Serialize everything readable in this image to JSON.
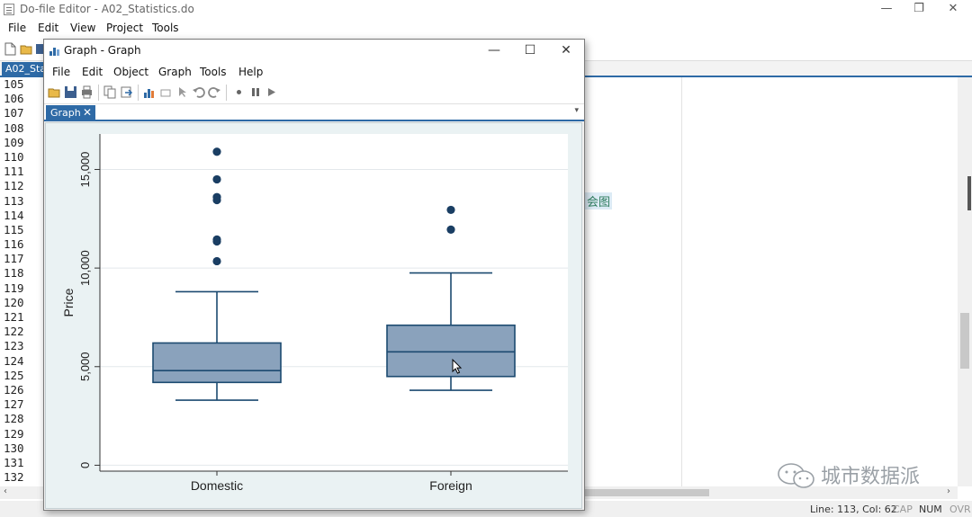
{
  "editor": {
    "title": "Do-file Editor - A02_Statistics.do",
    "menu": [
      "File",
      "Edit",
      "View",
      "Project",
      "Tools"
    ],
    "tab_label": "A02_Statistics.do",
    "line_numbers": [
      "105",
      "106",
      "107",
      "108",
      "109",
      "110",
      "111",
      "112",
      "113",
      "114",
      "115",
      "116",
      "117",
      "118",
      "119",
      "120",
      "121",
      "122",
      "123",
      "124",
      "125",
      "126",
      "127",
      "128",
      "129",
      "130",
      "131",
      "132"
    ],
    "code_snippet": "会图",
    "status": {
      "position": "Line: 113, Col: 62",
      "cap": "CAP",
      "num": "NUM",
      "ovr": "OVR"
    }
  },
  "watermark": "城市数据派",
  "graph_window": {
    "title": "Graph - Graph",
    "menu": [
      "File",
      "Edit",
      "Object",
      "Graph",
      "Tools",
      "Help"
    ],
    "tab_label": "Graph",
    "tab_close": "✕",
    "window_buttons": {
      "minimize": "—",
      "maximize": "☐",
      "close": "✕"
    }
  },
  "colors": {
    "box_fill": "#8aa2bc",
    "box_stroke": "#1c4a70",
    "outlier": "#1a3e63",
    "plot_bg": "#ffffff",
    "canvas_bg": "#eaf2f3",
    "grid": "#e3e8eb",
    "accent": "#2e6aa6"
  },
  "chart_data": {
    "type": "box",
    "title": "",
    "xlabel": "",
    "ylabel": "Price",
    "ylim": [
      -300,
      16800
    ],
    "yticks": [
      0,
      5000,
      10000,
      15000
    ],
    "ytick_labels": [
      "0",
      "5,000",
      "10,000",
      "15,000"
    ],
    "grid": true,
    "categories": [
      "Domestic",
      "Foreign"
    ],
    "boxes": [
      {
        "category": "Domestic",
        "whisker_low": 3300,
        "q1": 4200,
        "median": 4800,
        "q3": 6200,
        "whisker_high": 8800,
        "outliers": [
          10350,
          11350,
          11450,
          13450,
          13600,
          14500,
          15900
        ]
      },
      {
        "category": "Foreign",
        "whisker_low": 3800,
        "q1": 4500,
        "median": 5750,
        "q3": 7100,
        "whisker_high": 9750,
        "outliers": [
          11950,
          12950
        ]
      }
    ]
  }
}
